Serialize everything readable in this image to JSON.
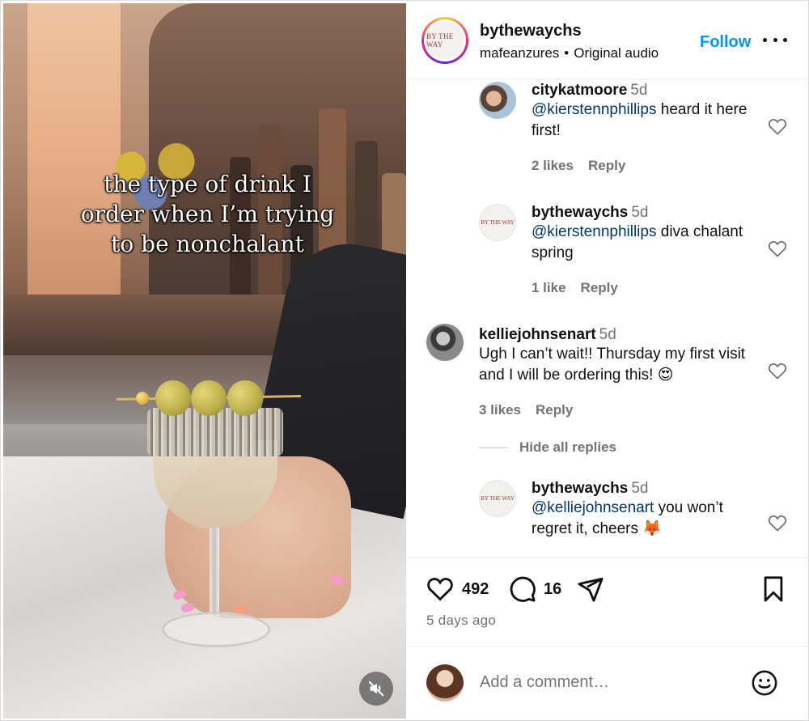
{
  "post": {
    "author": "bythewaychs",
    "brand_logo_text": "BY THE WAY",
    "audio_author": "mafeanzures",
    "audio_separator": "•",
    "audio_label": "Original audio",
    "follow_label": "Follow",
    "overlay_caption": "the type of drink I order when I’m trying to be nonchalant"
  },
  "comments": [
    {
      "user": "citykatmoore",
      "time": "5d",
      "mention": "@kierstennphillips",
      "text": " heard it here first!",
      "likes": "2 likes",
      "reply": "Reply"
    },
    {
      "user": "bythewaychs",
      "time": "5d",
      "mention": "@kierstennphillips",
      "text": " diva chalant spring",
      "likes": "1 like",
      "reply": "Reply"
    },
    {
      "user": "kelliejohnsenart",
      "time": "5d",
      "mention": "",
      "text": "Ugh I can’t wait!! Thursday my first visit and I will be ordering this! 😍",
      "likes": "3 likes",
      "reply": "Reply"
    },
    {
      "user": "bythewaychs",
      "time": "5d",
      "mention": "@kelliejohnsenart",
      "text": " you won’t regret it, cheers 🦊",
      "likes": "",
      "reply": ""
    }
  ],
  "hide_replies_label": "Hide all replies",
  "actions": {
    "like_count": "492",
    "comment_count": "16",
    "posted_ago": "5 days ago"
  },
  "add_comment": {
    "placeholder": "Add a comment…"
  },
  "colors": {
    "accent": "#0095f6",
    "mention": "#00376b",
    "muted": "#737373"
  },
  "icons": [
    "mute-icon",
    "more-icon",
    "heart-icon",
    "comment-icon",
    "share-icon",
    "bookmark-icon",
    "emoji-icon"
  ]
}
